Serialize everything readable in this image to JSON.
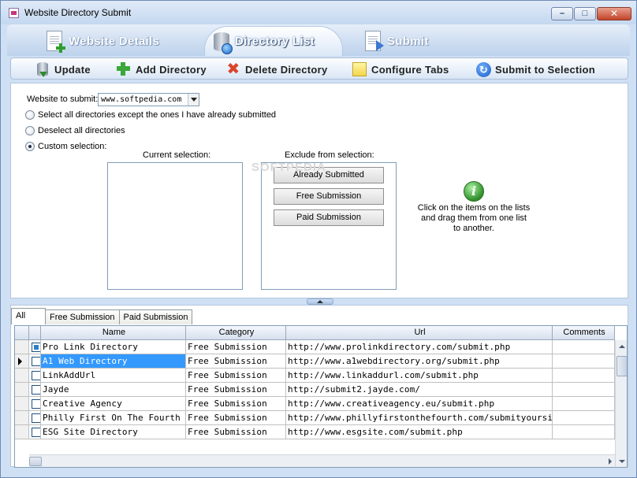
{
  "window": {
    "title": "Website Directory Submit"
  },
  "main_tabs": [
    {
      "label": "Website Details"
    },
    {
      "label": "Directory List"
    },
    {
      "label": "Submit"
    }
  ],
  "toolbar": {
    "update": "Update",
    "add_directory": "Add Directory",
    "delete_directory": "Delete Directory",
    "configure_tabs": "Configure Tabs",
    "submit_to_selection": "Submit to Selection"
  },
  "panel": {
    "website_label": "Website to submit:",
    "website_value": "www.softpedia.com",
    "radio_select_all": "Select all directories except the ones I have already submitted",
    "radio_deselect_all": "Deselect all directories",
    "radio_custom": "Custom selection:",
    "current_selection_label": "Current selection:",
    "exclude_label": "Exclude from selection:",
    "exclude_items": [
      "Already Submitted",
      "Free Submission",
      "Paid Submission"
    ],
    "info_text": "Click on the items on the lists and drag them from one list to another.",
    "watermark": "SOFTPEDIA"
  },
  "sub_tabs": [
    "All",
    "Free Submission",
    "Paid Submission"
  ],
  "grid": {
    "columns": [
      "Name",
      "Category",
      "Url",
      "Comments"
    ],
    "rows": [
      {
        "name": "Pro Link Directory",
        "category": "Free Submission",
        "url": "http://www.prolinkdirectory.com/submit.php",
        "comments": ""
      },
      {
        "name": "A1 Web Directory",
        "category": "Free Submission",
        "url": "http://www.a1webdirectory.org/submit.php",
        "comments": ""
      },
      {
        "name": "LinkAddUrl",
        "category": "Free Submission",
        "url": "http://www.linkaddurl.com/submit.php",
        "comments": ""
      },
      {
        "name": "Jayde",
        "category": "Free Submission",
        "url": "http://submit2.jayde.com/",
        "comments": ""
      },
      {
        "name": "Creative Agency",
        "category": "Free Submission",
        "url": "http://www.creativeagency.eu/submit.php",
        "comments": ""
      },
      {
        "name": "Philly First On The Fourth",
        "category": "Free Submission",
        "url": "http://www.phillyfirstonthefourth.com/submityoursite.html",
        "comments": ""
      },
      {
        "name": "ESG Site Directory",
        "category": "Free Submission",
        "url": "http://www.esgsite.com/submit.php",
        "comments": ""
      }
    ]
  }
}
